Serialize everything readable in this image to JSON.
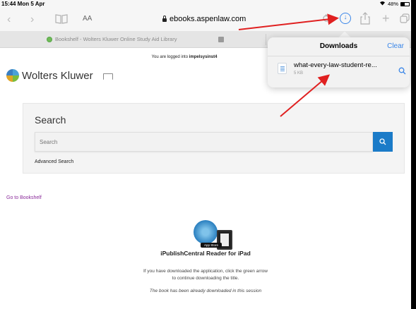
{
  "status_bar": {
    "time_date": "15:44 Mon 5 Apr",
    "battery_percent": "48%"
  },
  "toolbar": {
    "text_size_label": "AA",
    "url": "ebooks.aspenlaw.com",
    "icons": [
      "back-icon",
      "forward-icon",
      "bookmarks-icon",
      "reload-icon",
      "downloads-icon",
      "share-icon",
      "new-tab-icon",
      "tabs-icon"
    ]
  },
  "tab_bar": {
    "active_tab_title": "Bookshelf - Wolters Kluwer Online Study Aid Library"
  },
  "page": {
    "logged_in_prefix": "You are logged into",
    "logged_in_user": "impelsysinst4",
    "brand": "Wolters Kluwer",
    "search": {
      "title": "Search",
      "placeholder": "Search",
      "advanced_link": "Advanced Search"
    },
    "bookshelf_link": "Go to Bookshelf",
    "app": {
      "store_badge": "App Store",
      "title": "iPublishCentral Reader for iPad",
      "desc_line1": "If you have downloaded the application, click the green arrow",
      "desc_line2": "to continue downloading the title.",
      "note": "The book has been already downloaded in this session"
    }
  },
  "downloads_popover": {
    "title": "Downloads",
    "clear_label": "Clear",
    "file_name": "what-every-law-student-re...",
    "file_size": "5 KB"
  },
  "colors": {
    "accent_blue": "#3a86e8",
    "search_button": "#1b7bc8",
    "link_purple": "#8a2b9a",
    "annotation_red": "#e02020"
  }
}
